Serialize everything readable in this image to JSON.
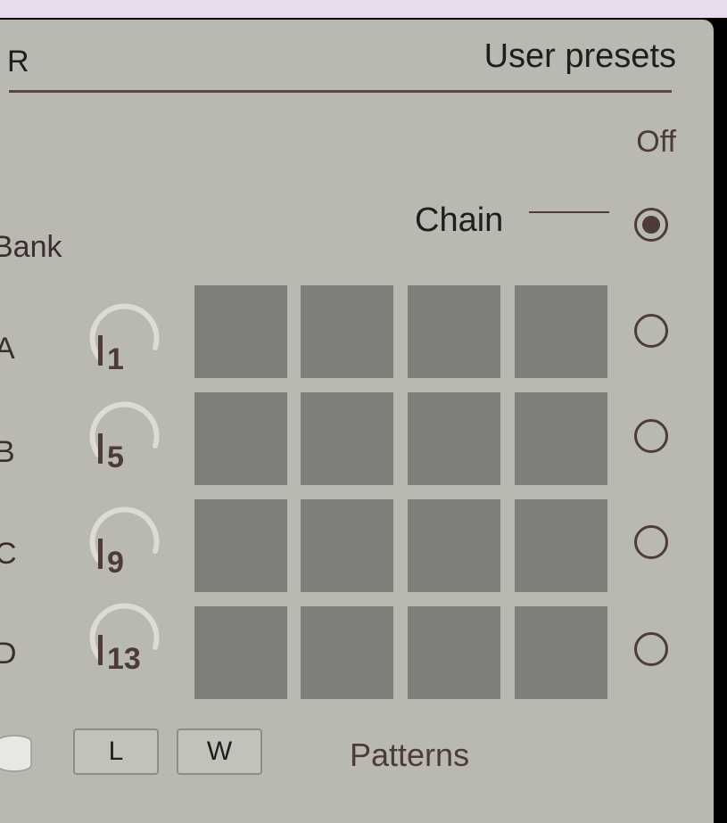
{
  "panel": {
    "left_label": "R",
    "title": "User presets",
    "off_label": "Off",
    "chain_label": "Chain",
    "bank_label": "Bank",
    "patterns_label": "Patterns"
  },
  "rows": [
    {
      "letter": "A",
      "knob_value": "1",
      "selected": false
    },
    {
      "letter": "B",
      "knob_value": "5",
      "selected": false
    },
    {
      "letter": "C",
      "knob_value": "9",
      "selected": false
    },
    {
      "letter": "D",
      "knob_value": "13",
      "selected": false
    }
  ],
  "chain_selected": true,
  "buttons": {
    "load": "L",
    "write": "W"
  },
  "icons": {
    "storage": "database-icon"
  },
  "colors": {
    "panel_bg": "#b9b9b1",
    "accent": "#4e3a3a",
    "cell": "#7e7f79",
    "top_bar": "#e8dbee"
  }
}
